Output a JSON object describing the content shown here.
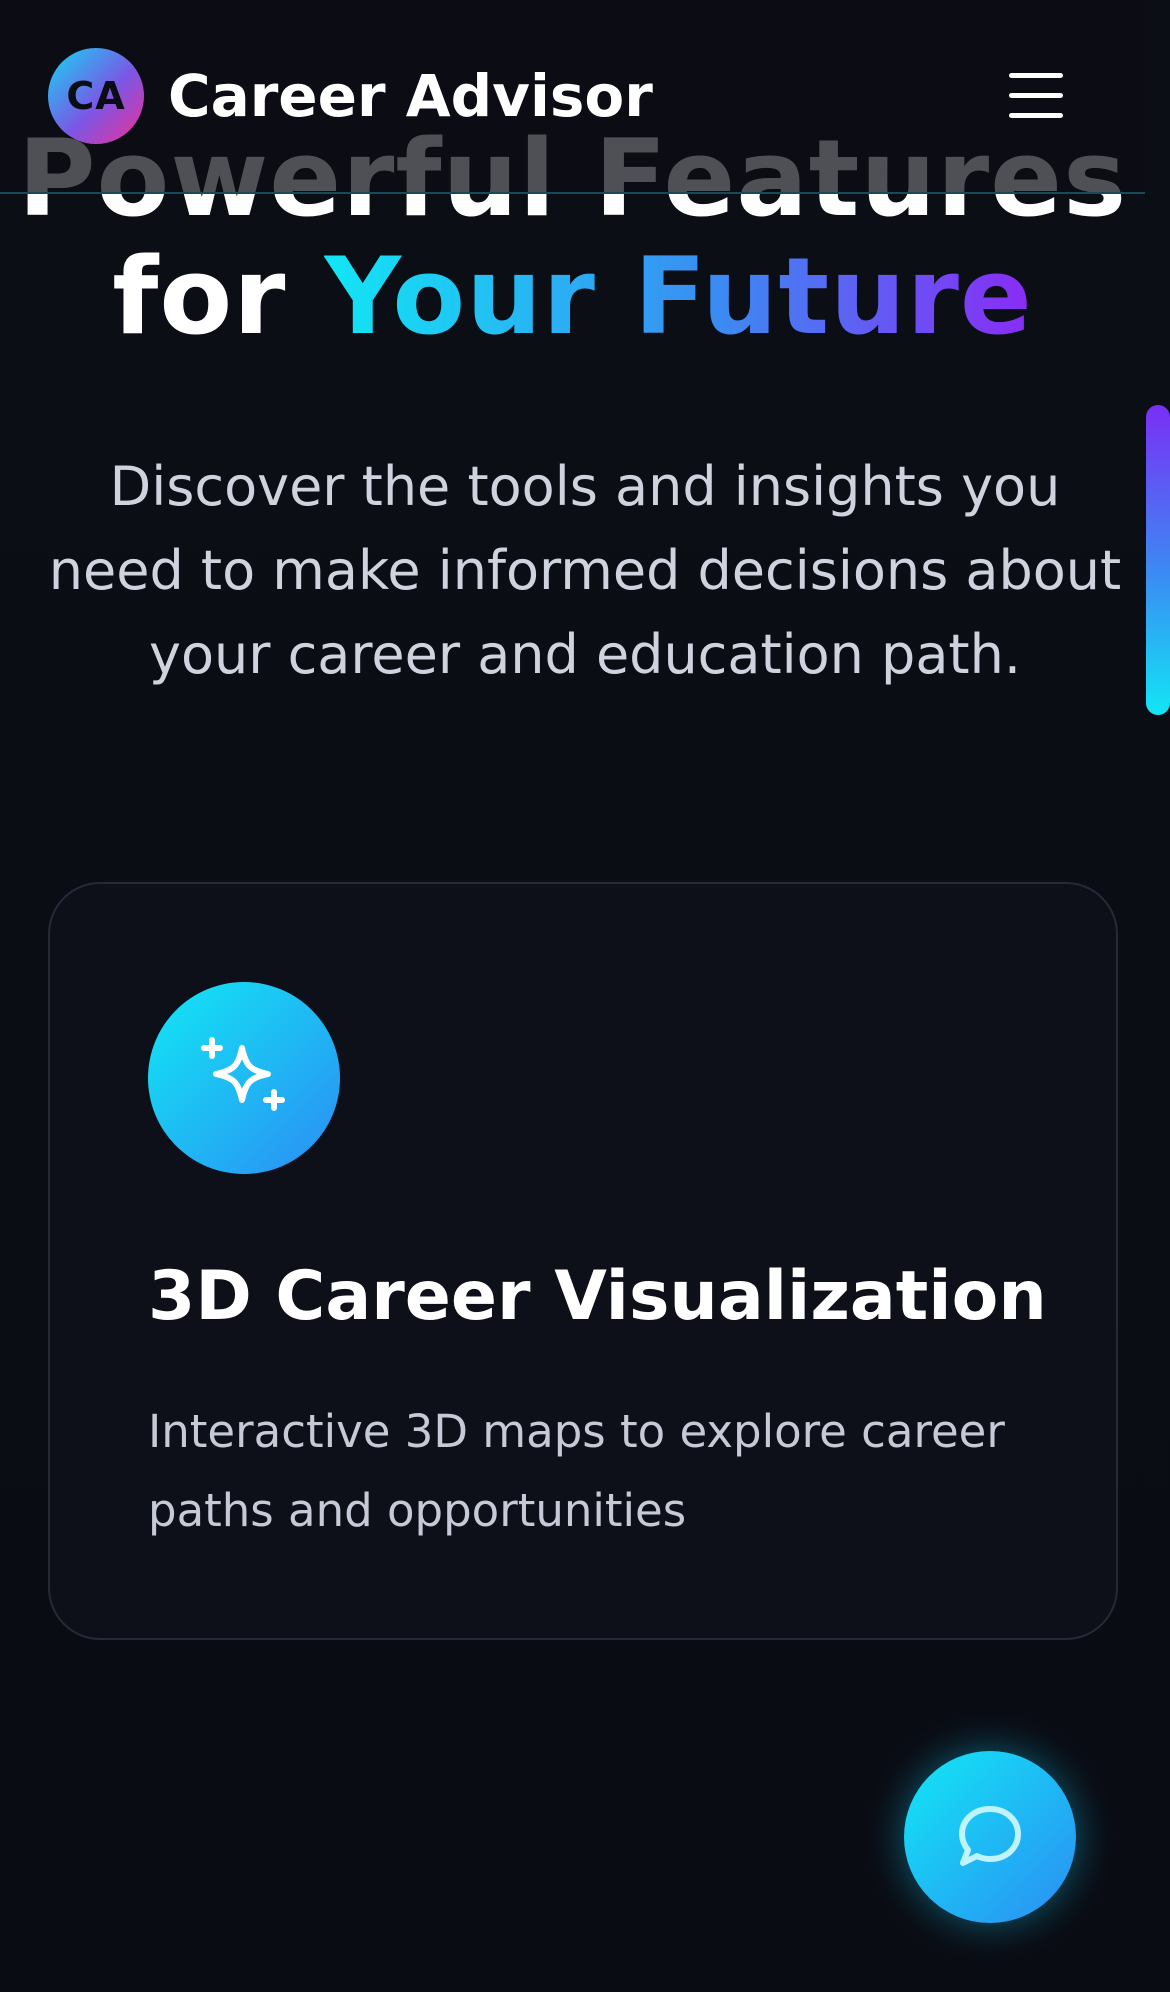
{
  "header": {
    "logo_initials": "CA",
    "brand_name": "Career Advisor",
    "menu_icon": "hamburger-menu-icon"
  },
  "hero": {
    "title_line1": "Powerful Features",
    "title_line2_prefix": "for ",
    "title_line2_highlight": "Your Future",
    "subtitle": "Discover the tools and insights you need to make informed decisions about your career and education path."
  },
  "features": [
    {
      "icon": "sparkles-icon",
      "title": "3D Career Visualization",
      "description": "Interactive 3D maps to explore career paths and opportunities"
    }
  ],
  "chat": {
    "icon": "chat-bubble-icon"
  },
  "colors": {
    "background": "#0b0d14",
    "accent_cyan": "#12e6f5",
    "accent_blue": "#3a8cf2",
    "accent_purple": "#8a2bf5",
    "accent_pink": "#f02e93"
  }
}
